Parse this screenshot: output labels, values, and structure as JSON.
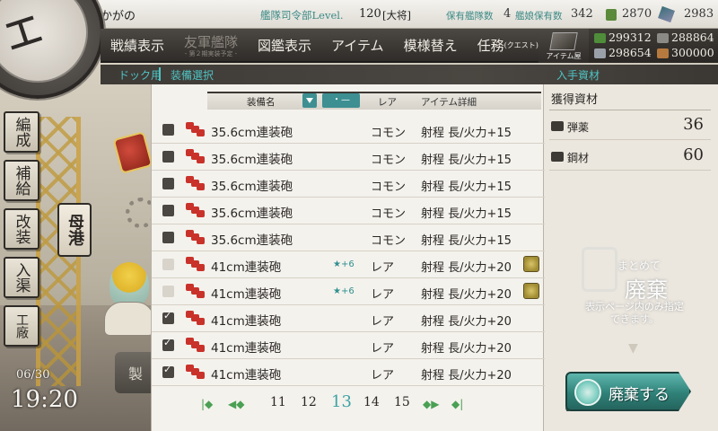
{
  "header": {
    "player_name": "かがの",
    "hq_label": "艦隊司令部Level.",
    "hq_level": "120",
    "rank": "[大将]",
    "ship_count_label": "保有艦隊数",
    "ship_count": "4",
    "equip_count_label": "艦娘保有数",
    "equip_count": "342",
    "top_res_1": "2870",
    "top_res_2": "2983"
  },
  "menu": {
    "items": [
      {
        "label": "戦績表示"
      },
      {
        "label": "友軍艦隊",
        "sub": "- 第２期実装予定 -"
      },
      {
        "label": "図鑑表示"
      },
      {
        "label": "アイテム"
      },
      {
        "label": "模様替え"
      },
      {
        "label": "任務",
        "suffix": "(クエスト)"
      }
    ],
    "item_store": "アイテム屋"
  },
  "resources": {
    "fuel": "299312",
    "ammo": "288864",
    "steel": "298654",
    "bauxite": "300000"
  },
  "breadcrumb": {
    "dock": "ドック用",
    "select": "装備選択",
    "gain": "入手資材"
  },
  "side_nav": {
    "sortie": "編成",
    "supply": "補給",
    "remodel": "改装",
    "dock": "入渠",
    "factory": "工廠",
    "port": "母港",
    "build_stub": "製"
  },
  "clock": {
    "date": "06/30",
    "time": "19:20"
  },
  "equipment_table": {
    "columns": {
      "name": "装備名",
      "filter": "・—",
      "rarity": "レア",
      "detail": "アイテム詳細"
    },
    "rows": [
      {
        "state": "unchecked",
        "name": "35.6cm連装砲",
        "star": "",
        "rarity": "コモン",
        "detail": "射程 長/火力+15",
        "locked": false
      },
      {
        "state": "unchecked",
        "name": "35.6cm連装砲",
        "star": "",
        "rarity": "コモン",
        "detail": "射程 長/火力+15",
        "locked": false
      },
      {
        "state": "unchecked",
        "name": "35.6cm連装砲",
        "star": "",
        "rarity": "コモン",
        "detail": "射程 長/火力+15",
        "locked": false
      },
      {
        "state": "unchecked",
        "name": "35.6cm連装砲",
        "star": "",
        "rarity": "コモン",
        "detail": "射程 長/火力+15",
        "locked": false
      },
      {
        "state": "unchecked",
        "name": "35.6cm連装砲",
        "star": "",
        "rarity": "コモン",
        "detail": "射程 長/火力+15",
        "locked": false
      },
      {
        "state": "disabled",
        "name": "41cm連装砲",
        "star": "★+6",
        "rarity": "レア",
        "detail": "射程 長/火力+20",
        "locked": true
      },
      {
        "state": "disabled",
        "name": "41cm連装砲",
        "star": "★+6",
        "rarity": "レア",
        "detail": "射程 長/火力+20",
        "locked": true
      },
      {
        "state": "checked",
        "name": "41cm連装砲",
        "star": "",
        "rarity": "レア",
        "detail": "射程 長/火力+20",
        "locked": false
      },
      {
        "state": "checked",
        "name": "41cm連装砲",
        "star": "",
        "rarity": "レア",
        "detail": "射程 長/火力+20",
        "locked": false
      },
      {
        "state": "checked",
        "name": "41cm連装砲",
        "star": "",
        "rarity": "レア",
        "detail": "射程 長/火力+20",
        "locked": false
      }
    ]
  },
  "pagination": {
    "pages": [
      "11",
      "12",
      "13",
      "14",
      "15"
    ],
    "current": "13"
  },
  "gain_panel": {
    "title": "獲得資材",
    "ammo_label": "弾薬",
    "ammo_value": "36",
    "steel_label": "鋼材",
    "steel_value": "60",
    "bulk_line1": "まとめて",
    "bulk_line2": "廃棄",
    "bulk_line3": "表示ページ内のみ指定できます。",
    "scrap_button": "廃棄する"
  }
}
